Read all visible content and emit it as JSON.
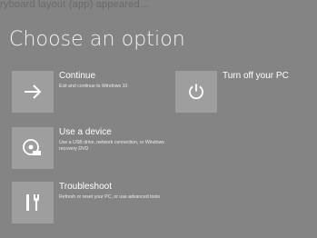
{
  "top_text": "ryboard layout  (app) appeared...",
  "screen": {
    "title": "Choose an option"
  },
  "options": [
    {
      "id": "continue",
      "title": "Continue",
      "description": "Exit and continue to Windows 10",
      "icon": "arrow-right-icon"
    },
    {
      "id": "turnoff",
      "title": "Turn off your PC",
      "description": "",
      "icon": "power-icon"
    },
    {
      "id": "device",
      "title": "Use a device",
      "description": "Use a USB drive, network connection, or Windows recovery DVD",
      "icon": "disc-device-icon"
    },
    {
      "id": "troubleshoot",
      "title": "Troubleshoot",
      "description": "Refresh or reset your PC, or use advanced tools",
      "icon": "tools-icon"
    }
  ],
  "colors": {
    "background": "#848484",
    "tile": "#9e9e9e",
    "text": "#ffffff"
  }
}
